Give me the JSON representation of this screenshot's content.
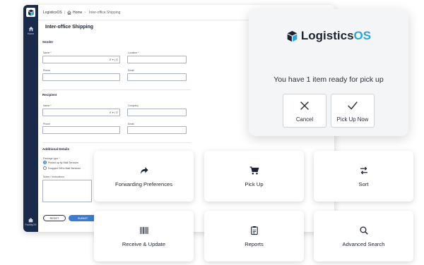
{
  "app": {
    "name": "LogisticsOS",
    "breadcrumb": {
      "home": "Home",
      "current": "Inter-office Shipping"
    },
    "sidebar": {
      "home_label": "Home",
      "facility_label": "FacilityOS"
    },
    "page_title": "Inter-office Shipping",
    "sender": {
      "heading": "Sender",
      "name_label": "Name *",
      "location_label": "Location *",
      "phone_label": "Phone",
      "email_label": "Email"
    },
    "recipient": {
      "heading": "Recipient",
      "name_label": "Name *",
      "company_label": "Company",
      "phone_label": "Phone",
      "email_label": "Email"
    },
    "additional": {
      "heading": "Additional Details",
      "select_label": "Package type *",
      "option_1": "Picked up by Mail Services",
      "option_2": "Dropped Off to Mail Services",
      "notes_label": "Notes / Instructions"
    },
    "buttons": {
      "reset": "RESET",
      "submit": "SUBMIT"
    }
  },
  "modal": {
    "brand_part1": "Logistics",
    "brand_part2": "OS",
    "message": "You have 1 item ready for pick up",
    "cancel_label": "Cancel",
    "pickup_label": "Pick Up Now",
    "brand_color": "#2aa6d8"
  },
  "tiles": {
    "forwarding": "Forwarding Preferences",
    "pickup": "Pick Up",
    "sort": "Sort",
    "receive": "Receive & Update",
    "reports": "Reports",
    "search": "Advanced Search"
  },
  "icons": {
    "forwarding": "share-arrow-icon",
    "pickup": "cart-icon",
    "sort": "swap-arrows-icon",
    "receive": "barcode-icon",
    "reports": "clipboard-icon",
    "search": "search-icon"
  }
}
